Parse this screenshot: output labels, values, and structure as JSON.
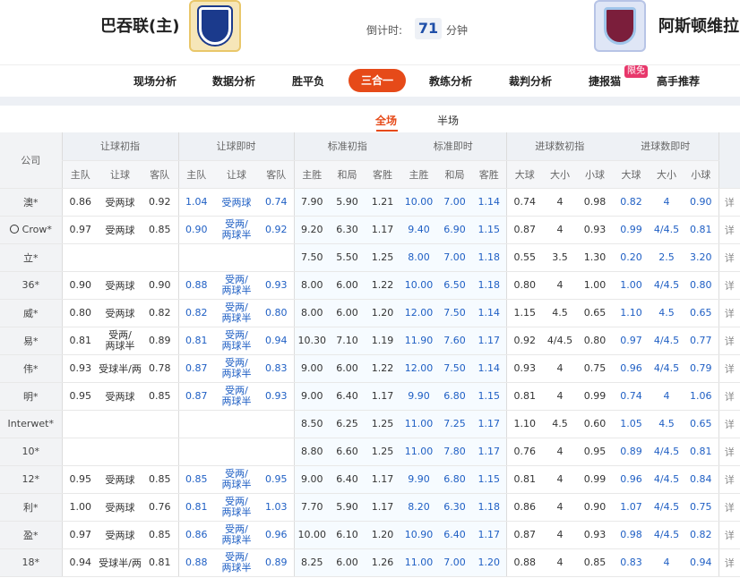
{
  "header": {
    "home_team": "巴吞联(主)",
    "away_team": "阿斯顿维拉",
    "countdown_label": "倒计时:",
    "countdown_value": "71",
    "countdown_unit": "分钟"
  },
  "nav": {
    "items": [
      "现场分析",
      "数据分析",
      "胜平负",
      "三合一",
      "教练分析",
      "裁判分析",
      "捷报猫",
      "高手推荐"
    ],
    "active": "三合一",
    "badge": "限免"
  },
  "subtabs": {
    "items": [
      "全场",
      "半场"
    ],
    "active": "全场"
  },
  "table": {
    "company_header": "公司",
    "groups": [
      "让球初指",
      "让球即时",
      "标准初指",
      "标准即时",
      "进球数初指",
      "进球数即时"
    ],
    "sub_headers": {
      "handicap": [
        "主队",
        "让球",
        "客队"
      ],
      "standard": [
        "主胜",
        "和局",
        "客胜"
      ],
      "goals": [
        "大球",
        "大小",
        "小球"
      ]
    },
    "detail_label": "详",
    "rows": [
      {
        "company": "澳*",
        "h_init": [
          "0.86",
          "受两球",
          "0.92"
        ],
        "h_live": [
          "1.04",
          "受两球",
          "0.74"
        ],
        "s_init": [
          "7.90",
          "5.90",
          "1.21"
        ],
        "s_live": [
          "10.00",
          "7.00",
          "1.14"
        ],
        "g_init": [
          "0.74",
          "4",
          "0.98"
        ],
        "g_live": [
          "0.82",
          "4",
          "0.90"
        ]
      },
      {
        "company": "Crow*",
        "h_init": [
          "0.97",
          "受两球",
          "0.85"
        ],
        "h_live": [
          "0.90",
          "受两/两球半",
          "0.92"
        ],
        "s_init": [
          "9.20",
          "6.30",
          "1.17"
        ],
        "s_live": [
          "9.40",
          "6.90",
          "1.15"
        ],
        "g_init": [
          "0.87",
          "4",
          "0.93"
        ],
        "g_live": [
          "0.99",
          "4/4.5",
          "0.81"
        ]
      },
      {
        "company": "立*",
        "h_init": [
          "",
          "",
          ""
        ],
        "h_live": [
          "",
          "",
          ""
        ],
        "s_init": [
          "7.50",
          "5.50",
          "1.25"
        ],
        "s_live": [
          "8.00",
          "7.00",
          "1.18"
        ],
        "g_init": [
          "0.55",
          "3.5",
          "1.30"
        ],
        "g_live": [
          "0.20",
          "2.5",
          "3.20"
        ]
      },
      {
        "company": "36*",
        "h_init": [
          "0.90",
          "受两球",
          "0.90"
        ],
        "h_live": [
          "0.88",
          "受两/两球半",
          "0.93"
        ],
        "s_init": [
          "8.00",
          "6.00",
          "1.22"
        ],
        "s_live": [
          "10.00",
          "6.50",
          "1.18"
        ],
        "g_init": [
          "0.80",
          "4",
          "1.00"
        ],
        "g_live": [
          "1.00",
          "4/4.5",
          "0.80"
        ]
      },
      {
        "company": "威*",
        "h_init": [
          "0.80",
          "受两球",
          "0.82"
        ],
        "h_live": [
          "0.82",
          "受两/两球半",
          "0.80"
        ],
        "s_init": [
          "8.00",
          "6.00",
          "1.20"
        ],
        "s_live": [
          "12.00",
          "7.50",
          "1.14"
        ],
        "g_init": [
          "1.15",
          "4.5",
          "0.65"
        ],
        "g_live": [
          "1.10",
          "4.5",
          "0.65"
        ]
      },
      {
        "company": "易*",
        "h_init": [
          "0.81",
          "受两/两球半",
          "0.89"
        ],
        "h_live": [
          "0.81",
          "受两/两球半",
          "0.94"
        ],
        "s_init": [
          "10.30",
          "7.10",
          "1.19"
        ],
        "s_live": [
          "11.90",
          "7.60",
          "1.17"
        ],
        "g_init": [
          "0.92",
          "4/4.5",
          "0.80"
        ],
        "g_live": [
          "0.97",
          "4/4.5",
          "0.77"
        ]
      },
      {
        "company": "伟*",
        "h_init": [
          "0.93",
          "受球半/两",
          "0.78"
        ],
        "h_live": [
          "0.87",
          "受两/两球半",
          "0.83"
        ],
        "s_init": [
          "9.00",
          "6.00",
          "1.22"
        ],
        "s_live": [
          "12.00",
          "7.50",
          "1.14"
        ],
        "g_init": [
          "0.93",
          "4",
          "0.75"
        ],
        "g_live": [
          "0.96",
          "4/4.5",
          "0.79"
        ]
      },
      {
        "company": "明*",
        "h_init": [
          "0.95",
          "受两球",
          "0.85"
        ],
        "h_live": [
          "0.87",
          "受两/两球半",
          "0.93"
        ],
        "s_init": [
          "9.00",
          "6.40",
          "1.17"
        ],
        "s_live": [
          "9.90",
          "6.80",
          "1.15"
        ],
        "g_init": [
          "0.81",
          "4",
          "0.99"
        ],
        "g_live": [
          "0.74",
          "4",
          "1.06"
        ]
      },
      {
        "company": "Interwet*",
        "h_init": [
          "",
          "",
          ""
        ],
        "h_live": [
          "",
          "",
          ""
        ],
        "s_init": [
          "8.50",
          "6.25",
          "1.25"
        ],
        "s_live": [
          "11.00",
          "7.25",
          "1.17"
        ],
        "g_init": [
          "1.10",
          "4.5",
          "0.60"
        ],
        "g_live": [
          "1.05",
          "4.5",
          "0.65"
        ]
      },
      {
        "company": "10*",
        "h_init": [
          "",
          "",
          ""
        ],
        "h_live": [
          "",
          "",
          ""
        ],
        "s_init": [
          "8.80",
          "6.60",
          "1.25"
        ],
        "s_live": [
          "11.00",
          "7.80",
          "1.17"
        ],
        "g_init": [
          "0.76",
          "4",
          "0.95"
        ],
        "g_live": [
          "0.89",
          "4/4.5",
          "0.81"
        ]
      },
      {
        "company": "12*",
        "h_init": [
          "0.95",
          "受两球",
          "0.85"
        ],
        "h_live": [
          "0.85",
          "受两/两球半",
          "0.95"
        ],
        "s_init": [
          "9.00",
          "6.40",
          "1.17"
        ],
        "s_live": [
          "9.90",
          "6.80",
          "1.15"
        ],
        "g_init": [
          "0.81",
          "4",
          "0.99"
        ],
        "g_live": [
          "0.96",
          "4/4.5",
          "0.84"
        ]
      },
      {
        "company": "利*",
        "h_init": [
          "1.00",
          "受两球",
          "0.76"
        ],
        "h_live": [
          "0.81",
          "受两/两球半",
          "1.03"
        ],
        "s_init": [
          "7.70",
          "5.90",
          "1.17"
        ],
        "s_live": [
          "8.20",
          "6.30",
          "1.18"
        ],
        "g_init": [
          "0.86",
          "4",
          "0.90"
        ],
        "g_live": [
          "1.07",
          "4/4.5",
          "0.75"
        ]
      },
      {
        "company": "盈*",
        "h_init": [
          "0.97",
          "受两球",
          "0.85"
        ],
        "h_live": [
          "0.86",
          "受两/两球半",
          "0.96"
        ],
        "s_init": [
          "10.00",
          "6.10",
          "1.20"
        ],
        "s_live": [
          "10.90",
          "6.40",
          "1.17"
        ],
        "g_init": [
          "0.87",
          "4",
          "0.93"
        ],
        "g_live": [
          "0.98",
          "4/4.5",
          "0.82"
        ]
      },
      {
        "company": "18*",
        "h_init": [
          "0.94",
          "受球半/两",
          "0.81"
        ],
        "h_live": [
          "0.88",
          "受两/两球半",
          "0.89"
        ],
        "s_init": [
          "8.25",
          "6.00",
          "1.26"
        ],
        "s_live": [
          "11.00",
          "7.00",
          "1.20"
        ],
        "g_init": [
          "0.88",
          "4",
          "0.85"
        ],
        "g_live": [
          "0.83",
          "4",
          "0.94"
        ]
      }
    ]
  }
}
